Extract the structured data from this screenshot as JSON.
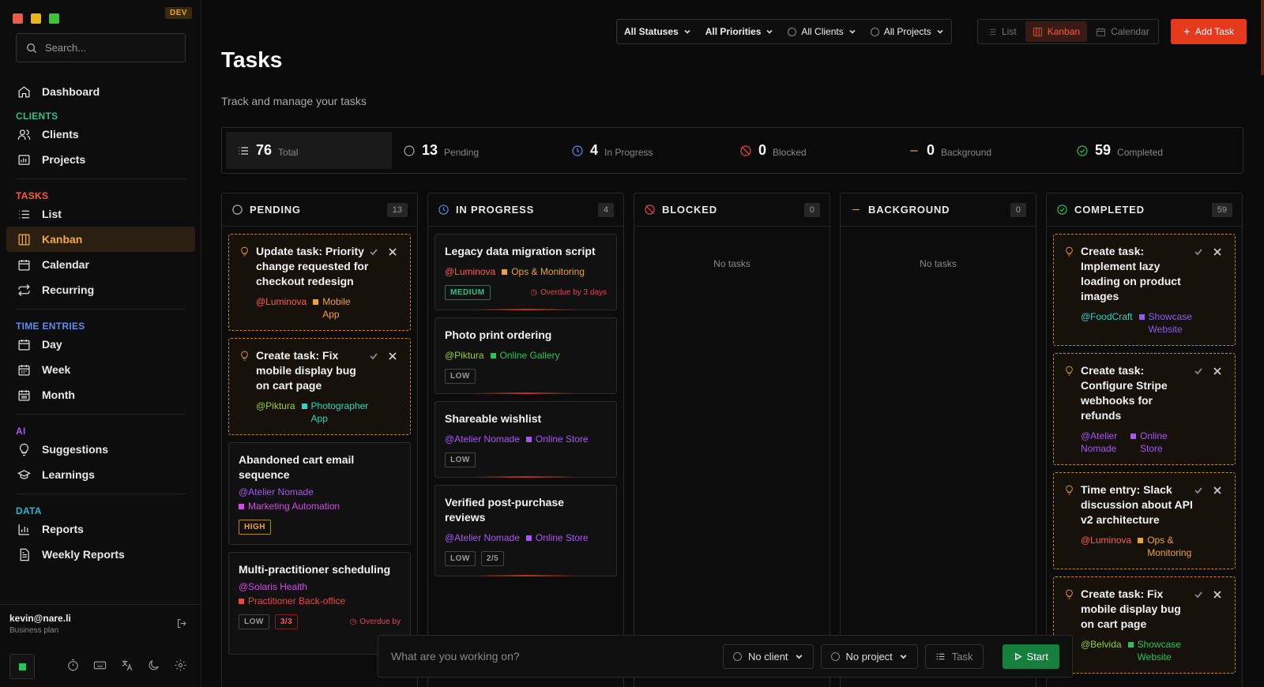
{
  "app": {
    "env_badge": "DEV",
    "colors": {
      "accent": "#f0a94a",
      "brand": "#e63a1f",
      "success": "#22c55e"
    }
  },
  "sidebar": {
    "search_placeholder": "Search...",
    "dashboard": "Dashboard",
    "sections": {
      "clients": "CLIENTS",
      "tasks": "TASKS",
      "time": "TIME ENTRIES",
      "ai": "AI",
      "data": "DATA"
    },
    "items": {
      "clients": "Clients",
      "projects": "Projects",
      "list": "List",
      "kanban": "Kanban",
      "calendar": "Calendar",
      "recurring": "Recurring",
      "day": "Day",
      "week": "Week",
      "month": "Month",
      "suggestions": "Suggestions",
      "learnings": "Learnings",
      "reports": "Reports",
      "weekly_reports": "Weekly Reports"
    },
    "user": {
      "email": "kevin@nare.li",
      "plan": "Business plan"
    }
  },
  "toolbar": {
    "filters": [
      "All Statuses",
      "All Priorities",
      "All Clients",
      "All Projects"
    ],
    "views": {
      "list": "List",
      "kanban": "Kanban",
      "calendar": "Calendar"
    },
    "add_task": "Add Task"
  },
  "page": {
    "title": "Tasks",
    "subtitle": "Track and manage your tasks"
  },
  "stats": {
    "total": {
      "num": "76",
      "label": "Total"
    },
    "pending": {
      "num": "13",
      "label": "Pending"
    },
    "in_progress": {
      "num": "4",
      "label": "In Progress"
    },
    "blocked": {
      "num": "0",
      "label": "Blocked"
    },
    "background": {
      "num": "0",
      "label": "Background"
    },
    "completed": {
      "num": "59",
      "label": "Completed"
    }
  },
  "columns": {
    "pending": {
      "title": "PENDING",
      "count": "13"
    },
    "in_progress": {
      "title": "IN PROGRESS",
      "count": "4"
    },
    "blocked": {
      "title": "BLOCKED",
      "count": "0",
      "empty": "No tasks"
    },
    "background": {
      "title": "BACKGROUND",
      "count": "0",
      "empty": "No tasks"
    },
    "completed": {
      "title": "COMPLETED",
      "count": "59"
    }
  },
  "cards": {
    "p1": {
      "title": "Update task: Priority change requested for checkout redesign",
      "client": "@Luminova",
      "project": "Mobile App"
    },
    "p2": {
      "title": "Create task: Fix mobile display bug on cart page",
      "client": "@Piktura",
      "project": "Photographer App"
    },
    "p3": {
      "title": "Abandoned cart email sequence",
      "client": "@Atelier Nomade",
      "project": "Marketing Automation",
      "priority": "HIGH"
    },
    "p4": {
      "title": "Multi-practitioner scheduling",
      "client": "@Solaris Health",
      "project": "Practitioner Back-office",
      "priority": "LOW",
      "subtasks": "3/3",
      "overdue": "Overdue by"
    },
    "i1": {
      "title": "Legacy data migration script",
      "client": "@Luminova",
      "project": "Ops & Monitoring",
      "priority": "MEDIUM",
      "overdue": "Overdue by 3 days"
    },
    "i2": {
      "title": "Photo print ordering",
      "client": "@Piktura",
      "project": "Online Gallery",
      "priority": "LOW"
    },
    "i3": {
      "title": "Shareable wishlist",
      "client": "@Atelier Nomade",
      "project": "Online Store",
      "priority": "LOW"
    },
    "i4": {
      "title": "Verified post-purchase reviews",
      "client": "@Atelier Nomade",
      "project": "Online Store",
      "priority": "LOW",
      "subtasks": "2/5"
    },
    "c1": {
      "title": "Create task: Implement lazy loading on product images",
      "client": "@FoodCraft",
      "project": "Showcase Website"
    },
    "c2": {
      "title": "Create task: Configure Stripe webhooks for refunds",
      "client": "@Atelier Nomade",
      "project": "Online Store"
    },
    "c3": {
      "title": "Time entry: Slack discussion about API v2 architecture",
      "client": "@Luminova",
      "project": "Ops & Monitoring"
    },
    "c4": {
      "title": "Create task: Fix mobile display bug on cart page",
      "client": "@Belvida",
      "project": "Showcase Website"
    }
  },
  "tracker": {
    "placeholder": "What are you working on?",
    "client": "No client",
    "project": "No project",
    "task": "Task",
    "start": "Start"
  }
}
